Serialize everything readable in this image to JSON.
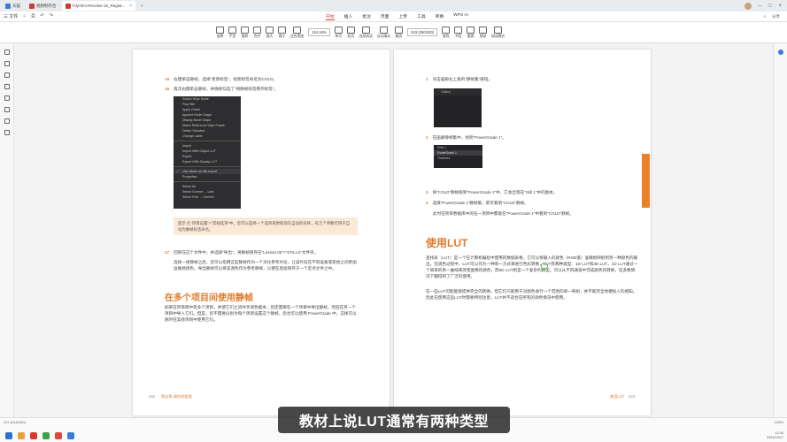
{
  "titlebar": {
    "tabs": [
      {
        "label": "天猫",
        "color": "#3a7bd5",
        "active": false
      },
      {
        "label": "视频制作合",
        "color": "#d23c2e",
        "active": false
      },
      {
        "label": "TdyVkct-Revolve-18_Regist...",
        "color": "#d23c2e",
        "active": true
      }
    ],
    "add_tab": "+"
  },
  "menubar": {
    "left": [
      "三 文件",
      "⌂",
      "⎙",
      "↶",
      "↷"
    ],
    "tabs": [
      "开始",
      "插入",
      "批注",
      "页面",
      "上传",
      "工具",
      "转换",
      "AI"
    ],
    "active_tab": "开始",
    "ai_label": "WPS AI",
    "right": [
      "⌕",
      "分享"
    ]
  },
  "toolbar": {
    "tools": [
      "选择",
      "手型",
      "旋转",
      "合并",
      "放大",
      "缩小",
      "适合宽度",
      "单页",
      "双页",
      "连续阅读",
      "自动滚动",
      "翻页",
      "查找",
      "书签",
      "截图",
      "朗读",
      "阅读模式"
    ],
    "zoom": "124.16%",
    "page": "243 (250/430)"
  },
  "left_page": {
    "steps": [
      {
        "num": "15",
        "text": "右键单击静帧，选择“更改标签”，给新标签命名为COLD。"
      },
      {
        "num": "16",
        "text": "再次右键单击静帧，并确保勾选了“将静帧标签用作标签”。"
      }
    ],
    "menu_items": [
      "Switch Wipe Mode",
      "Play Still",
      "Apply Grade",
      "Append Node Graph",
      "Display Node Graph",
      "Match Reference Wipe Frame",
      "Delete Selected",
      "Change Label",
      "Import",
      "Import With Output LUT",
      "Export",
      "Export With Display LUT",
      "Use labels on still export",
      "Properties",
      "Select All",
      "Select Current → Last",
      "Select First → Current"
    ],
    "menu_checked_index": 12,
    "callout": "提示 在“项目设置”>“常规选项”中，您可以选择一个选项来更新现在自动的名称，有几个参数可用于自动为静帧标签命名。",
    "step17": {
      "num": "17",
      "text": "回到在这个文件中，并选择“导出”，将静帧保存在“Lesson 05”>“STILLS”文件夹。"
    },
    "para17": "选择一组静帧之后，您可以指明这些静帧作为一个对比参考片段，让该片段在不同设备或系统之间更加准确地调色。导出静帧可以将该调色作为参考静帧，以便在后续保存于一个定点文件之中。",
    "heading": "在多个项目间使用静帧",
    "para_bottom": "如果在项目库中有多个项目，并使它们之间共享调色版本，您还需要在一个项目中导出静帧，然后在另一个项目中导入它们。但是，您不需要分别为每个项目设置这个静帧，您也可以使用 PowerGrade 中，这样可以随时在其他项目中使用它们。",
    "footer_num": "242",
    "footer_text": "第五章  调色的管理"
  },
  "right_page": {
    "steps": [
      {
        "num": "1",
        "text": "点击画廊左上角的“静帧集”按钮。"
      },
      {
        "num": "2",
        "text": "在画廊静帧集中，找到“PowerGrade 1”。"
      },
      {
        "num": "3",
        "text": "将“COLD”静帧拖到“PowerGrade 1”中，它会出现在“Still 1”中的副本。"
      },
      {
        "num": "4",
        "text": "选择“PowerGrade 1”静帧集，即可看到“COLD”静帧。"
      }
    ],
    "para_after4": "此时在项目数据库中的任一项目中都能在“PowerGrade 1”中看到“COLD”静帧。",
    "gallery_title": "Gallery",
    "still_items": [
      "Stills 1",
      "PowerGrade 1",
      "Timelines"
    ],
    "heading": "使用LUT",
    "para1": "查找表（LUT）是一个在计算机编程中使用的数据表格，它可以将输入的颜色（RGB值）准确地映射到另一种颜色的输出。在调色过程中，LUT可以作为一种单一方式来进行色彩转换，LUT有两种类型：1D LUT和3D LUT。1D LUT通过一个简单的单一曲线来改变图像的颜色，而3D LUT则是一个复杂的模型，可以从不同通道中完成颜色的转换，在多数情况下都得到了广泛的使用。",
    "para2": "在一些LUT可能能够提供完全的转换，但它们只能用于对颜色进行一个范围的单一映射，并不能完全地模拟人的感知。因此在使用这些LUT时需要特别注意，LUT并不适合在所有的调色情况中使用。",
    "footer_num": "243",
    "footer_text": "使用LUT"
  },
  "statusbar": {
    "page_info": "242 (249/430)",
    "zoom": "125%",
    "time": "12:44",
    "date": "2024/10/17"
  },
  "subtitle": "教材上说LUT通常有两种类型"
}
